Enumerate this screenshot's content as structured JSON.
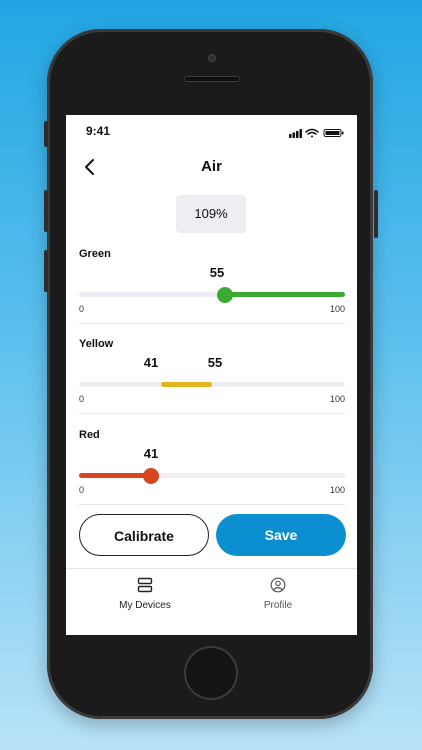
{
  "status_bar": {
    "time": "9:41"
  },
  "header": {
    "title": "Air",
    "back_icon": "chevron-left-icon"
  },
  "readout": {
    "value": "109%"
  },
  "ranges": {
    "green": {
      "label": "Green",
      "value": "55",
      "min": "0",
      "max": "100",
      "color": "#3aaa35",
      "fill_from": 55,
      "fill_to": 100
    },
    "yellow": {
      "label": "Yellow",
      "low": "41",
      "high": "55",
      "min": "0",
      "max": "100",
      "color": "#e1b51b",
      "fill_from": 31,
      "fill_to": 50
    },
    "red": {
      "label": "Red",
      "value": "41",
      "min": "0",
      "max": "100",
      "color": "#d8461f",
      "fill_from": 0,
      "fill_to": 27
    }
  },
  "actions": {
    "calibrate": "Calibrate",
    "save": "Save"
  },
  "tabs": [
    {
      "label": "My Devices",
      "icon": "devices-icon",
      "active": true
    },
    {
      "label": "Profile",
      "icon": "profile-icon",
      "active": false
    }
  ],
  "colors": {
    "accent": "#0c8fd1",
    "track": "#eceef1"
  }
}
